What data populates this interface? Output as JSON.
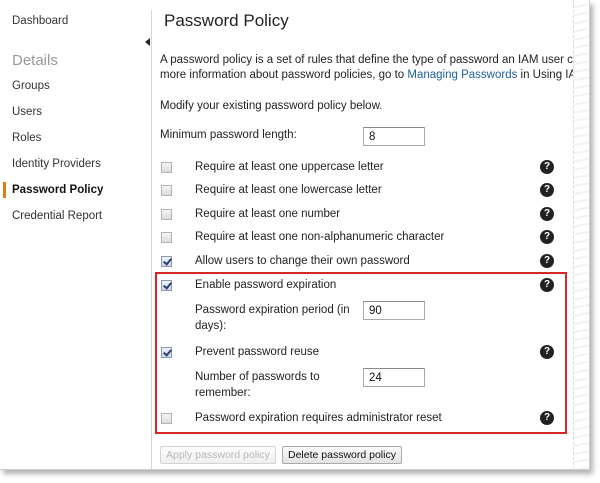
{
  "sidebar": {
    "dashboard": "Dashboard",
    "section_heading": "Details",
    "items": [
      {
        "label": "Groups"
      },
      {
        "label": "Users"
      },
      {
        "label": "Roles"
      },
      {
        "label": "Identity Providers"
      },
      {
        "label": "Password Policy",
        "active": true
      },
      {
        "label": "Credential Report"
      }
    ]
  },
  "main": {
    "title": "Password Policy",
    "intro_line1": "A password policy is a set of rules that define the type of password an IAM user can s",
    "intro_line2_prefix": "more information about password policies, go to ",
    "intro_link": "Managing Passwords",
    "intro_line2_suffix": " in Using IAM.",
    "modify_text": "Modify your existing password policy below.",
    "min_length_label": "Minimum password length:",
    "min_length_value": "8",
    "options": [
      {
        "label": "Require at least one uppercase letter",
        "checked": false
      },
      {
        "label": "Require at least one lowercase letter",
        "checked": false
      },
      {
        "label": "Require at least one number",
        "checked": false
      },
      {
        "label": "Require at least one non-alphanumeric character",
        "checked": false
      },
      {
        "label": "Allow users to change their own password",
        "checked": true
      }
    ],
    "expiration": {
      "label": "Enable password expiration",
      "checked": true,
      "period_label": "Password expiration period (in days):",
      "period_value": "90"
    },
    "reuse": {
      "label": "Prevent password reuse",
      "checked": true,
      "remember_label": "Number of passwords to remember:",
      "remember_value": "24"
    },
    "admin_reset": {
      "label": "Password expiration requires administrator reset",
      "checked": false
    },
    "help_glyph": "?",
    "apply_button": "Apply password policy",
    "delete_button": "Delete password policy"
  },
  "colors": {
    "highlight_border": "#d62728",
    "active_nav_marker": "#e17d10",
    "link": "#1f5f9e"
  }
}
